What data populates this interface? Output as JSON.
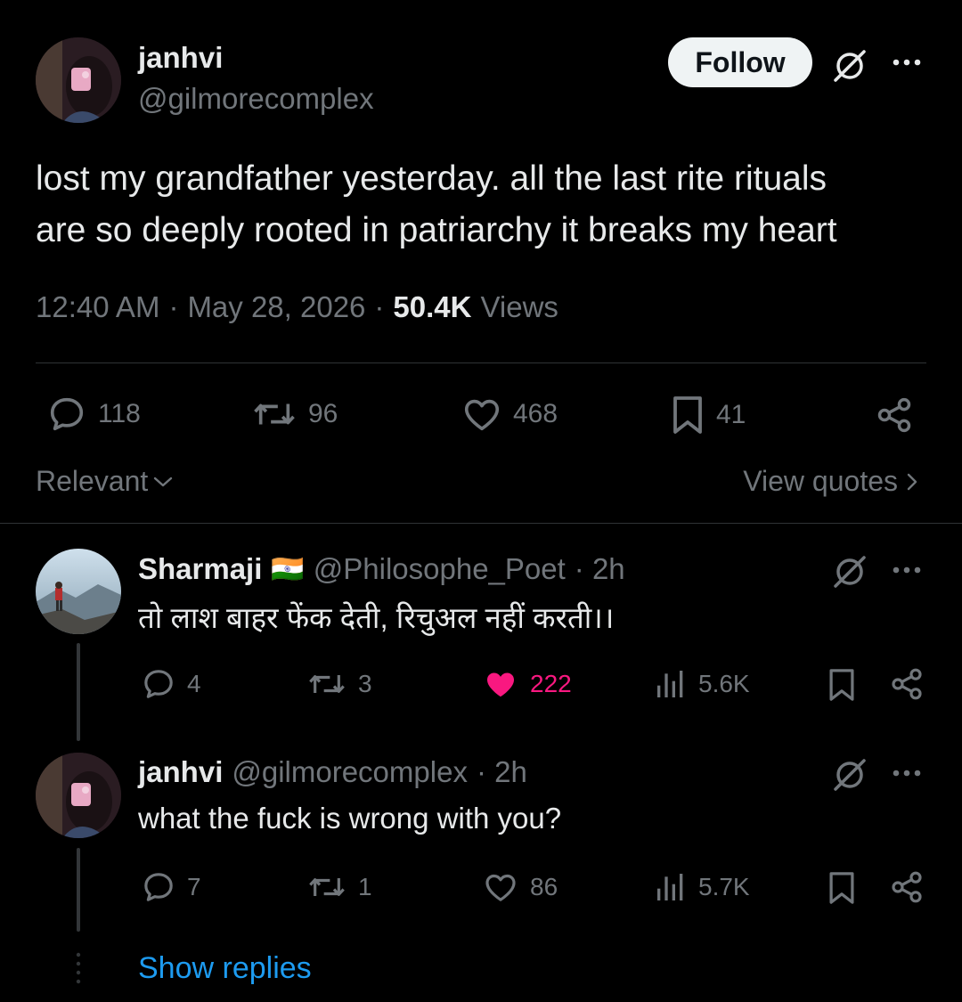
{
  "main_tweet": {
    "author_name": "janhvi",
    "author_handle": "@gilmorecomplex",
    "follow_label": "Follow",
    "text_line1": "lost my grandfather yesterday. all the last rite rituals",
    "text_line2": "are so deeply rooted in patriarchy it breaks my heart",
    "time": "12:40 AM",
    "sep1": "·",
    "date": "May 28, 2026",
    "sep2": "·",
    "views_count": "50.4K",
    "views_label": "Views",
    "replies": "118",
    "retweets": "96",
    "likes": "468",
    "bookmarks": "41"
  },
  "sort": {
    "label": "Relevant",
    "view_quotes": "View quotes"
  },
  "replies": [
    {
      "author_name": "Sharmaji",
      "flag": "🇮🇳",
      "author_handle": "@Philosophe_Poet",
      "time": "· 2h",
      "text": "तो लाश बाहर फेंक देती, रिचुअल नहीं करती।।",
      "replies": "4",
      "retweets": "3",
      "likes": "222",
      "liked": true,
      "views": "5.6K"
    },
    {
      "author_name": "janhvi",
      "author_handle": "@gilmorecomplex",
      "time": "· 2h",
      "text": "what the fuck is wrong with you?",
      "replies": "7",
      "retweets": "1",
      "likes": "86",
      "liked": false,
      "views": "5.7K"
    }
  ],
  "show_replies": "Show replies",
  "colors": {
    "background": "#000000",
    "text": "#e7e9ea",
    "muted": "#71767b",
    "like": "#f91880",
    "link": "#1d9bf0"
  }
}
